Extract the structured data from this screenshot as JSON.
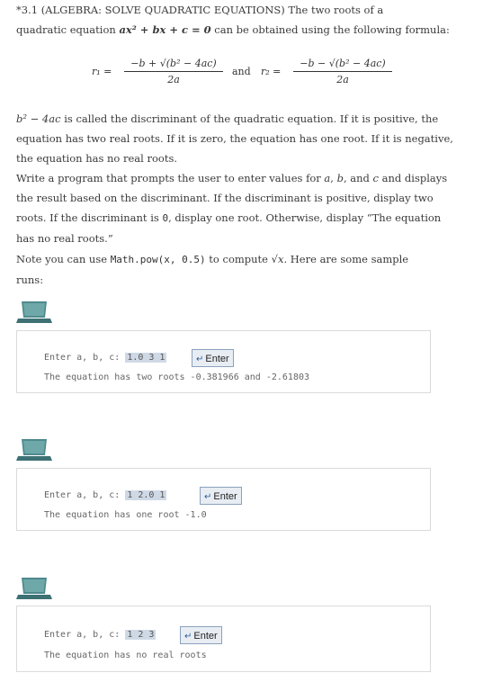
{
  "heading": {
    "label": "*3.1 (ALGEBRA: SOLVE QUADRATIC EQUATIONS)",
    "text1": " The two roots of a",
    "text2": "quadratic equation ",
    "equation": "ax² + bx + c = 0",
    "text3": " can be obtained using the following formula:"
  },
  "formula": {
    "r1": "r₁ =",
    "r1_num": "−b + √(b² − 4ac)",
    "r1_den": "2a",
    "and": "and",
    "r2": "r₂ =",
    "r2_num": "−b − √(b² − 4ac)",
    "r2_den": "2a"
  },
  "discriminant": {
    "term": "b² − 4ac",
    "line1": " is called the discriminant of the quadratic equation. If it is positive, the",
    "line2": "equation has two real roots. If it is zero, the equation has one root. If it is negative,",
    "line3": "the equation has no real roots."
  },
  "task": {
    "line1a": "Write a program that prompts the user to enter values for ",
    "a": "a",
    "sep1": ", ",
    "b": "b",
    "sep2": ", and ",
    "c": "c",
    "line1b": " and displays",
    "line2": "the result based on the discriminant. If the discriminant is positive, display two",
    "line3a": "roots. If the discriminant is ",
    "zero": "0",
    "line3b": ", display one root. Otherwise, display “The equation",
    "line4": "has no real roots.”"
  },
  "note": {
    "text1": "Note you can use ",
    "code": "Math.pow(x, 0.5)",
    "text2": " to compute ",
    "sqrt": "√x",
    "text3": ". Here are some sample",
    "text4": "runs:"
  },
  "runs": [
    {
      "prompt": "Enter a, b, c: ",
      "input": "1.0 3 1",
      "enter": "Enter",
      "output": "The equation has two roots -0.381966 and -2.61803"
    },
    {
      "prompt": "Enter a, b, c: ",
      "input": "1 2.0 1",
      "enter": "Enter",
      "output": "The equation has one root -1.0"
    },
    {
      "prompt": "Enter a, b, c: ",
      "input": "1 2 3",
      "enter": "Enter",
      "output": "The equation has no real roots"
    }
  ],
  "colors": {
    "laptop": "#4e8a8d",
    "input_bg": "#cfd9e6",
    "enter_border": "#8aa2bd"
  }
}
